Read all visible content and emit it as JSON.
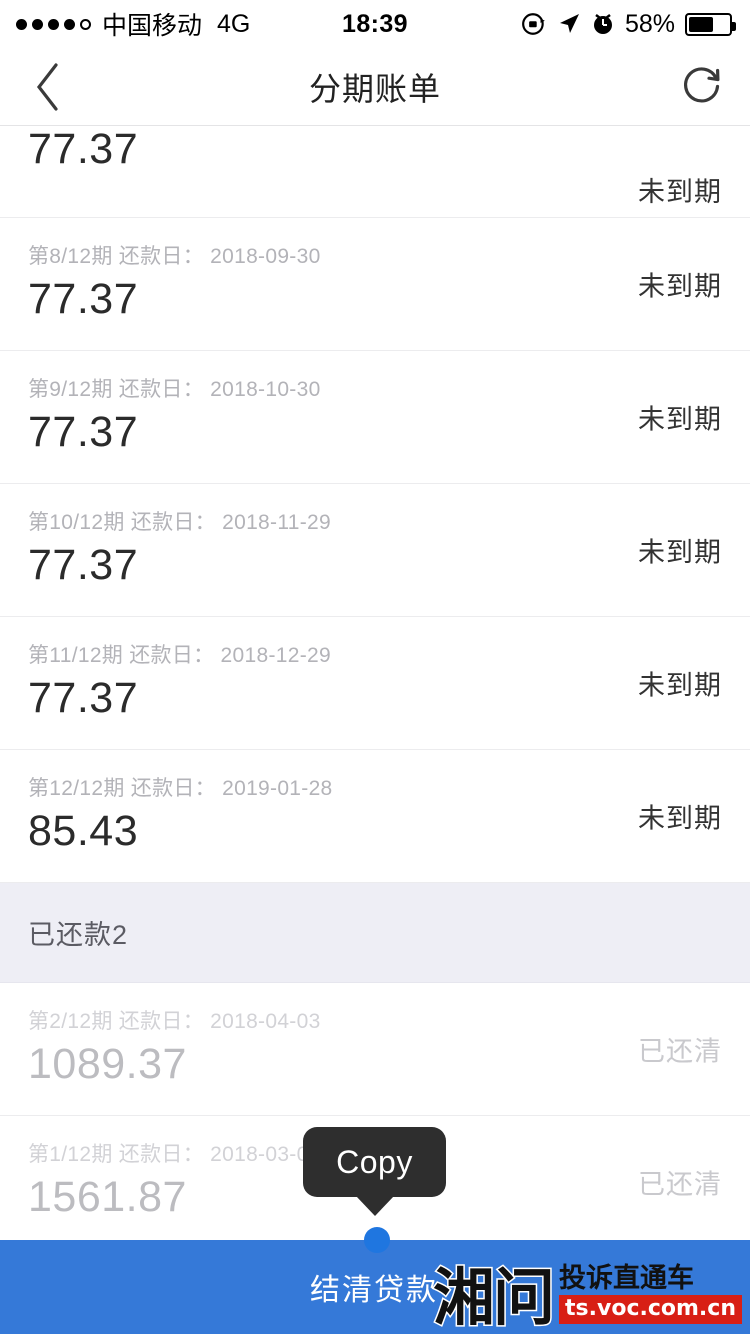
{
  "statusbar": {
    "signal_dots_filled": 4,
    "signal_dots_total": 5,
    "carrier": "中国移动",
    "network": "4G",
    "time": "18:39",
    "battery_percent": "58%",
    "icons": [
      "rotation-lock-icon",
      "location-arrow-icon",
      "alarm-clock-icon",
      "battery-icon"
    ]
  },
  "navbar": {
    "back_icon": "chevron-left-icon",
    "title": "分期账单",
    "refresh_icon": "refresh-icon"
  },
  "list": {
    "rows": [
      {
        "label": "",
        "amount": "77.37",
        "status": "未到期",
        "paid": false,
        "partial": true
      },
      {
        "label": "第8/12期 还款日： 2018-09-30",
        "amount": "77.37",
        "status": "未到期",
        "paid": false
      },
      {
        "label": "第9/12期 还款日： 2018-10-30",
        "amount": "77.37",
        "status": "未到期",
        "paid": false
      },
      {
        "label": "第10/12期 还款日： 2018-11-29",
        "amount": "77.37",
        "status": "未到期",
        "paid": false
      },
      {
        "label": "第11/12期 还款日： 2018-12-29",
        "amount": "77.37",
        "status": "未到期",
        "paid": false
      },
      {
        "label": "第12/12期 还款日： 2019-01-28",
        "amount": "85.43",
        "status": "未到期",
        "paid": false
      }
    ],
    "section_header": "已还款2",
    "paid_rows": [
      {
        "label": "第2/12期 还款日： 2018-04-03",
        "amount": "1089.37",
        "status": "已还清",
        "paid": true
      },
      {
        "label": "第1/12期 还款日： 2018-03-03",
        "amount": "1561.87",
        "status": "已还清",
        "paid": true
      }
    ]
  },
  "tooltip": {
    "label": "Copy"
  },
  "bottombar": {
    "label": "结清贷款",
    "color": "#3579d8"
  },
  "watermark": {
    "logo": "湘问",
    "subtitle": "投诉直通车",
    "url": "ts.voc.com.cn",
    "url_bg": "#d81f15"
  },
  "colors": {
    "accent_blue": "#3579d8",
    "handle_blue": "#1f76e0",
    "section_bg": "#eeeef5",
    "label_grey": "#b3b3b8",
    "paid_grey": "#c9c9cd",
    "amount_dark": "#2b2b2b"
  }
}
